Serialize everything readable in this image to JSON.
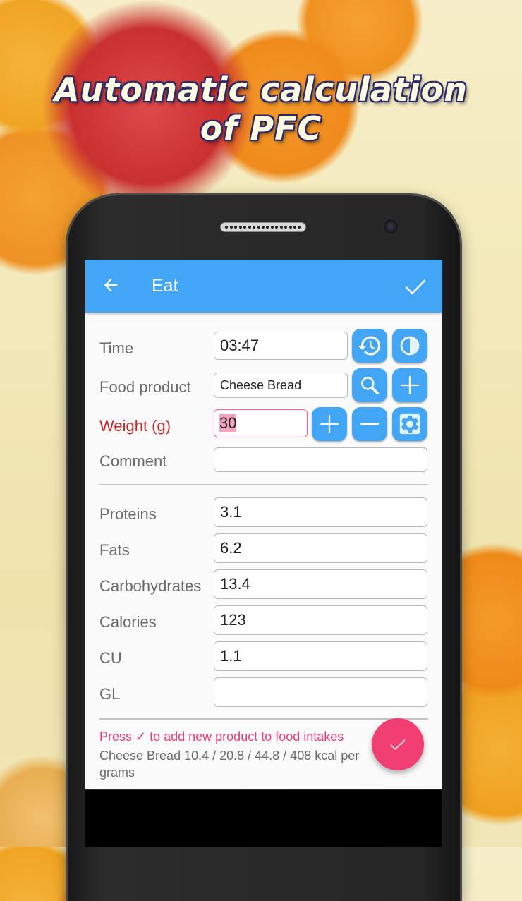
{
  "promo": {
    "headline_line1": "Automatic calculation",
    "headline_line2": "of PFC"
  },
  "appbar": {
    "back_icon": "arrow-left-icon",
    "title": "Eat",
    "confirm_icon": "check-icon"
  },
  "form": {
    "time": {
      "label": "Time",
      "value": "03:47",
      "buttons": [
        "history-icon",
        "clock-icon"
      ]
    },
    "food_product": {
      "label": "Food product",
      "value": "Cheese Bread",
      "buttons": [
        "search-icon",
        "plus-icon"
      ]
    },
    "weight": {
      "label": "Weight (g)",
      "value": "30",
      "buttons": [
        "plus-icon",
        "minus-icon",
        "gear-icon"
      ]
    },
    "comment": {
      "label": "Comment",
      "value": ""
    }
  },
  "nutrition": {
    "proteins": {
      "label": "Proteins",
      "value": "3.1"
    },
    "fats": {
      "label": "Fats",
      "value": "6.2"
    },
    "carbohydrates": {
      "label": "Carbohydrates",
      "value": "13.4"
    },
    "calories": {
      "label": "Calories",
      "value": "123"
    },
    "cu": {
      "label": "CU",
      "value": "1.1"
    },
    "gl": {
      "label": "GL",
      "value": ""
    }
  },
  "footer": {
    "hint": "Press ✓ to add new product to food intakes",
    "product_info": "Cheese Bread  10.4 / 20.8 / 44.8 / 408 kcal per grams"
  },
  "fab": {
    "icon": "check-icon"
  },
  "colors": {
    "appbar": "#42a5f5",
    "button": "#42a5f5",
    "fab": "#f23f73",
    "hint": "#e83e78",
    "required_label": "#c62828"
  }
}
